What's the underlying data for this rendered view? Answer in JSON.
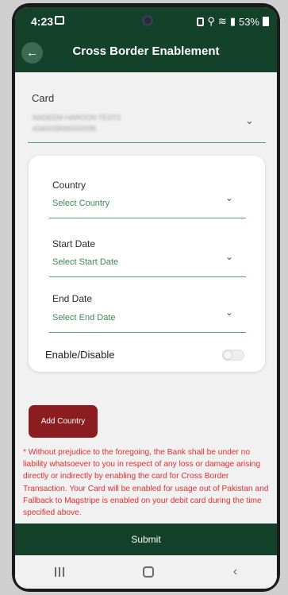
{
  "status_bar": {
    "time": "4:23",
    "battery": "53%"
  },
  "header": {
    "title": "Cross Border Enablement",
    "back_icon": "arrow-left-icon"
  },
  "card": {
    "label": "Card",
    "masked_name": "NADEEM HAROON TEST2",
    "masked_number": "4340039000000095"
  },
  "form": {
    "country": {
      "label": "Country",
      "placeholder": "Select Country"
    },
    "start_date": {
      "label": "Start Date",
      "placeholder": "Select Start Date"
    },
    "end_date": {
      "label": "End Date",
      "placeholder": "Select End Date"
    },
    "toggle": {
      "label": "Enable/Disable",
      "enabled": false
    }
  },
  "add_country_label": "Add Country",
  "disclaimer": "* Without prejudice to the foregoing, the Bank shall be under no liability whatsoever to you in respect of any loss or damage arising directly or indirectly by enabling the card for Cross Border Transaction. Your Card will be enabled for usage out of Pakistan and Fallback to Magstripe is enabled on your debit card during the time specified above.",
  "submit_label": "Submit",
  "colors": {
    "header_green": "#13412a",
    "accent_green": "#3e8a52",
    "button_red": "#8b1c1f",
    "disclaimer_red": "#e0302e"
  }
}
